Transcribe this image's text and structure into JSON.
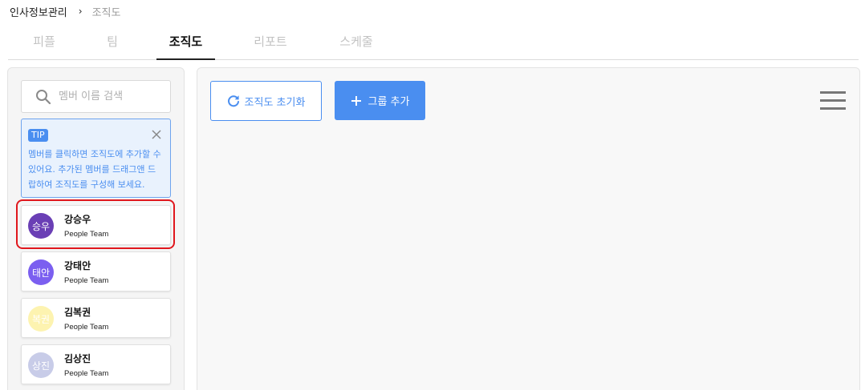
{
  "breadcrumb": {
    "root": "인사정보관리",
    "separator": "›",
    "current": "조직도"
  },
  "tabs": [
    {
      "label": "피플",
      "active": false
    },
    {
      "label": "팀",
      "active": false
    },
    {
      "label": "조직도",
      "active": true
    },
    {
      "label": "리포트",
      "active": false
    },
    {
      "label": "스케줄",
      "active": false
    }
  ],
  "search": {
    "placeholder": "멤버 이름 검색",
    "value": "",
    "icon": "search-icon"
  },
  "tip": {
    "badge": "TIP",
    "text": "멤버를 클릭하면 조직도에 추가할 수 있어요. 추가된 멤버를 드래그앤 드랍하여 조직도를 구성해 보세요.",
    "close_icon": "close-icon"
  },
  "members": [
    {
      "avatar_text": "승우",
      "name": "강승우",
      "team": "People Team",
      "avatar_color": "#6a3fb5",
      "highlighted": true
    },
    {
      "avatar_text": "태안",
      "name": "강태안",
      "team": "People Team",
      "avatar_color": "#7b5ff0"
    },
    {
      "avatar_text": "복권",
      "name": "김복권",
      "team": "People Team",
      "avatar_color": "#fdf3b0"
    },
    {
      "avatar_text": "상진",
      "name": "김상진",
      "team": "People Team",
      "avatar_color": "#c8cce8"
    }
  ],
  "toolbar": {
    "reset_label": "조직도 초기화",
    "reset_icon": "refresh-icon",
    "add_group_label": "그룹 추가",
    "add_icon": "plus-icon",
    "menu_icon": "hamburger-menu-icon"
  },
  "colors": {
    "accent": "#4a8ef0",
    "tip_background": "#e9f2fd",
    "highlight": "#e0171d",
    "inactive_tab": "#c2c2c2"
  }
}
